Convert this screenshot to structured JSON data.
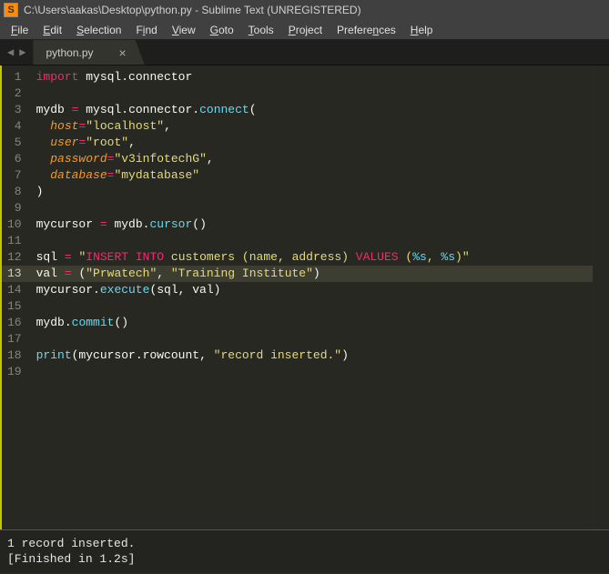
{
  "titlebar": {
    "path": "C:\\Users\\aakas\\Desktop\\python.py - Sublime Text (UNREGISTERED)"
  },
  "menubar": {
    "items": [
      {
        "label": "File",
        "key": "F"
      },
      {
        "label": "Edit",
        "key": "E"
      },
      {
        "label": "Selection",
        "key": "S"
      },
      {
        "label": "Find",
        "key": "i"
      },
      {
        "label": "View",
        "key": "V"
      },
      {
        "label": "Goto",
        "key": "G"
      },
      {
        "label": "Tools",
        "key": "T"
      },
      {
        "label": "Project",
        "key": "P"
      },
      {
        "label": "Preferences",
        "key": "n"
      },
      {
        "label": "Help",
        "key": "H"
      }
    ]
  },
  "tabs": {
    "active": {
      "label": "python.py"
    }
  },
  "editor": {
    "lines": [
      {
        "n": 1,
        "tokens": [
          {
            "t": "import",
            "c": "kw"
          },
          {
            "t": " mysql",
            "c": "plain"
          },
          {
            "t": ".",
            "c": "plain"
          },
          {
            "t": "connector",
            "c": "plain"
          }
        ]
      },
      {
        "n": 2,
        "tokens": []
      },
      {
        "n": 3,
        "tokens": [
          {
            "t": "mydb ",
            "c": "plain"
          },
          {
            "t": "=",
            "c": "op"
          },
          {
            "t": " mysql",
            "c": "plain"
          },
          {
            "t": ".",
            "c": "plain"
          },
          {
            "t": "connector",
            "c": "plain"
          },
          {
            "t": ".",
            "c": "plain"
          },
          {
            "t": "connect",
            "c": "fn"
          },
          {
            "t": "(",
            "c": "plain"
          }
        ]
      },
      {
        "n": 4,
        "tokens": [
          {
            "t": "  ",
            "c": "plain"
          },
          {
            "t": "host",
            "c": "param"
          },
          {
            "t": "=",
            "c": "op"
          },
          {
            "t": "\"localhost\"",
            "c": "str"
          },
          {
            "t": ",",
            "c": "plain"
          }
        ]
      },
      {
        "n": 5,
        "tokens": [
          {
            "t": "  ",
            "c": "plain"
          },
          {
            "t": "user",
            "c": "param"
          },
          {
            "t": "=",
            "c": "op"
          },
          {
            "t": "\"root\"",
            "c": "str"
          },
          {
            "t": ",",
            "c": "plain"
          }
        ]
      },
      {
        "n": 6,
        "tokens": [
          {
            "t": "  ",
            "c": "plain"
          },
          {
            "t": "password",
            "c": "param"
          },
          {
            "t": "=",
            "c": "op"
          },
          {
            "t": "\"v3infotechG\"",
            "c": "str"
          },
          {
            "t": ",",
            "c": "plain"
          }
        ]
      },
      {
        "n": 7,
        "tokens": [
          {
            "t": "  ",
            "c": "plain"
          },
          {
            "t": "database",
            "c": "param"
          },
          {
            "t": "=",
            "c": "op"
          },
          {
            "t": "\"mydatabase\"",
            "c": "str"
          }
        ]
      },
      {
        "n": 8,
        "tokens": [
          {
            "t": ")",
            "c": "plain"
          }
        ]
      },
      {
        "n": 9,
        "tokens": []
      },
      {
        "n": 10,
        "tokens": [
          {
            "t": "mycursor ",
            "c": "plain"
          },
          {
            "t": "=",
            "c": "op"
          },
          {
            "t": " mydb",
            "c": "plain"
          },
          {
            "t": ".",
            "c": "plain"
          },
          {
            "t": "cursor",
            "c": "fn"
          },
          {
            "t": "()",
            "c": "plain"
          }
        ]
      },
      {
        "n": 11,
        "tokens": []
      },
      {
        "n": 12,
        "tokens": [
          {
            "t": "sql ",
            "c": "plain"
          },
          {
            "t": "=",
            "c": "op"
          },
          {
            "t": " ",
            "c": "plain"
          },
          {
            "t": "\"",
            "c": "str"
          },
          {
            "t": "INSERT INTO",
            "c": "kw"
          },
          {
            "t": " customers ",
            "c": "str-plain"
          },
          {
            "t": "(",
            "c": "str-plain"
          },
          {
            "t": "name",
            "c": "str-plain"
          },
          {
            "t": ", ",
            "c": "str-plain"
          },
          {
            "t": "address",
            "c": "str-plain"
          },
          {
            "t": ") ",
            "c": "str-plain"
          },
          {
            "t": "VALUES",
            "c": "kw"
          },
          {
            "t": " (",
            "c": "str-plain"
          },
          {
            "t": "%s",
            "c": "fn"
          },
          {
            "t": ", ",
            "c": "str-plain"
          },
          {
            "t": "%s",
            "c": "fn"
          },
          {
            "t": ")",
            "c": "str-plain"
          },
          {
            "t": "\"",
            "c": "str"
          }
        ]
      },
      {
        "n": 13,
        "hl": true,
        "tokens": [
          {
            "t": "val ",
            "c": "plain"
          },
          {
            "t": "=",
            "c": "op"
          },
          {
            "t": " (",
            "c": "plain"
          },
          {
            "t": "\"Prwatech\"",
            "c": "str"
          },
          {
            "t": ", ",
            "c": "plain"
          },
          {
            "t": "\"Training Institute\"",
            "c": "str"
          },
          {
            "t": ")",
            "c": "plain"
          }
        ]
      },
      {
        "n": 14,
        "tokens": [
          {
            "t": "mycursor",
            "c": "plain"
          },
          {
            "t": ".",
            "c": "plain"
          },
          {
            "t": "execute",
            "c": "fn"
          },
          {
            "t": "(sql, val)",
            "c": "plain"
          }
        ]
      },
      {
        "n": 15,
        "tokens": []
      },
      {
        "n": 16,
        "tokens": [
          {
            "t": "mydb",
            "c": "plain"
          },
          {
            "t": ".",
            "c": "plain"
          },
          {
            "t": "commit",
            "c": "fn"
          },
          {
            "t": "()",
            "c": "plain"
          }
        ]
      },
      {
        "n": 17,
        "tokens": []
      },
      {
        "n": 18,
        "tokens": [
          {
            "t": "print",
            "c": "fn"
          },
          {
            "t": "(mycursor",
            "c": "plain"
          },
          {
            "t": ".",
            "c": "plain"
          },
          {
            "t": "rowcount, ",
            "c": "plain"
          },
          {
            "t": "\"record inserted.\"",
            "c": "str"
          },
          {
            "t": ")",
            "c": "plain"
          }
        ]
      },
      {
        "n": 19,
        "tokens": []
      }
    ]
  },
  "console": {
    "line1": "1 record inserted.",
    "line2": "[Finished in 1.2s]"
  }
}
